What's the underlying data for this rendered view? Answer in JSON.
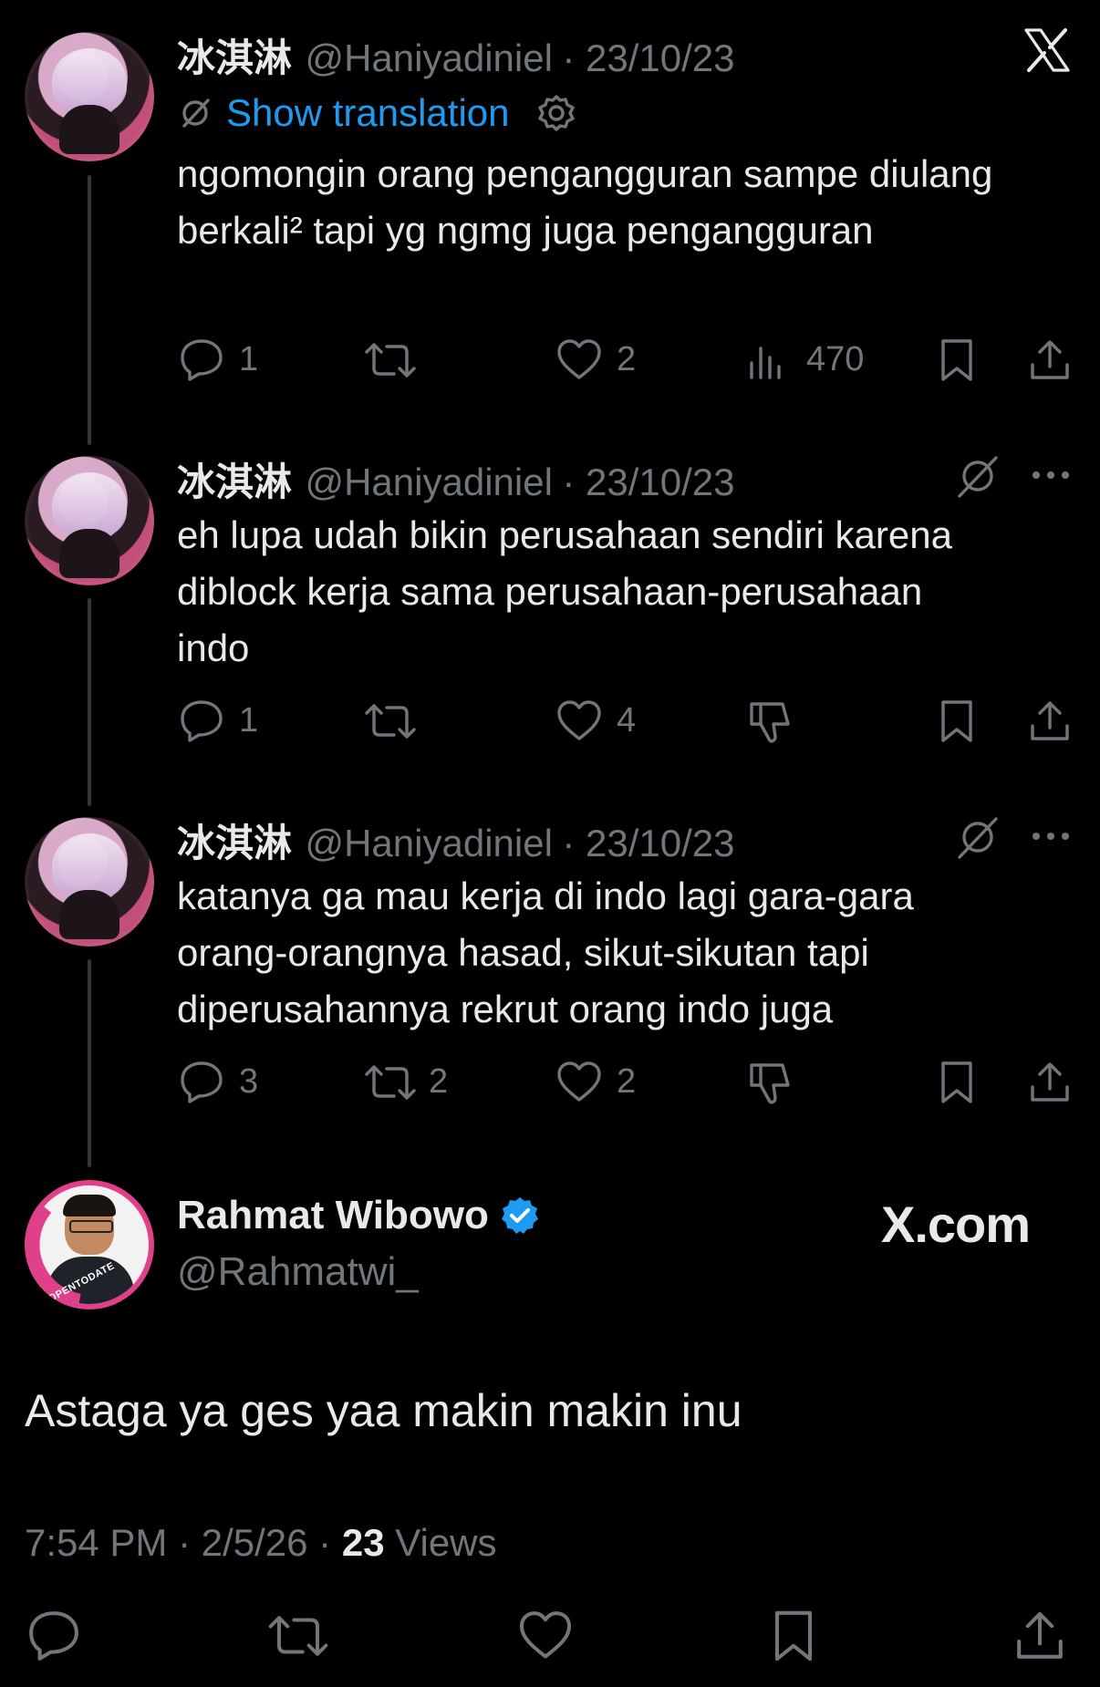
{
  "tweets": [
    {
      "name": "冰淇淋",
      "handle": "@Haniyadiniel",
      "date": "· 23/10/23",
      "translate_label": "Show translation",
      "text": "ngomongin orang pengangguran sampe diulang berkali² tapi yg ngmg juga pengangguran",
      "replies": "1",
      "retweets": "",
      "likes": "2",
      "views": "470"
    },
    {
      "name": "冰淇淋",
      "handle": "@Haniyadiniel",
      "date": "· 23/10/23",
      "text": "eh lupa udah bikin perusahaan sendiri karena diblock kerja sama perusahaan-perusahaan indo",
      "replies": "1",
      "retweets": "",
      "likes": "4"
    },
    {
      "name": "冰淇淋",
      "handle": "@Haniyadiniel",
      "date": "· 23/10/23",
      "text": "katanya ga mau kerja di indo lagi gara-gara orang-orangnya hasad, sikut-sikutan tapi diperusahannya rekrut orang indo juga",
      "replies": "3",
      "retweets": "2",
      "likes": "2"
    }
  ],
  "main": {
    "name": "Rahmat Wibowo",
    "handle": "@Rahmatwi_",
    "badge_text": "#OPENTODATE",
    "brand": "X.com",
    "text": "Astaga ya ges yaa makin makin inu",
    "time": "7:54 PM · 2/5/26 · ",
    "views_count": "23",
    "views_label": " Views"
  },
  "colors": {
    "background": "#000000",
    "text": "#e7e9ea",
    "muted": "#71767b",
    "link": "#1d9bf0",
    "verified": "#1d9bf0",
    "avatar_ring": "#e0408a"
  }
}
